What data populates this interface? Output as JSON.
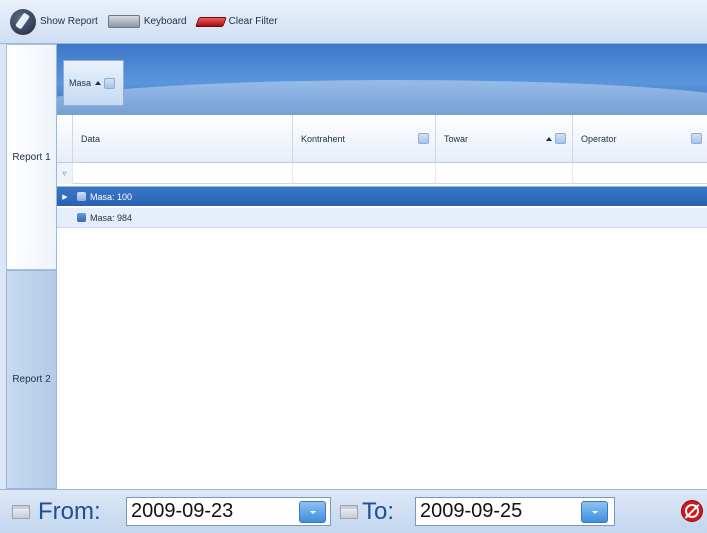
{
  "toolbar": {
    "show_report_label": "Show Report",
    "keyboard_label": "Keyboard",
    "clear_filter_label": "Clear Filter"
  },
  "tabs": [
    {
      "label": "Report 1",
      "selected": true
    },
    {
      "label": "Report 2",
      "selected": false
    }
  ],
  "grid": {
    "group_by_column": "Masa",
    "columns": [
      {
        "label": "Data"
      },
      {
        "label": "Kontrahent"
      },
      {
        "label": "Towar"
      },
      {
        "label": "Operator"
      }
    ],
    "rows": [
      {
        "label": "Masa: 100",
        "selected": true
      },
      {
        "label": "Masa: 984",
        "selected": false
      }
    ]
  },
  "date_range": {
    "from_label": "From:",
    "from_value": "2009-09-23",
    "to_label": "To:",
    "to_value": "2009-09-25"
  },
  "icons": {
    "report": "report-pen-icon",
    "keyboard": "keyboard-icon",
    "clear_filter": "eraser-icon",
    "calendar": "calendar-icon",
    "cancel": "cancel-icon"
  },
  "colors": {
    "accent": "#2f6cbc",
    "selected_row": "#3a77c9",
    "date_label": "#1f4f96",
    "cancel": "#d21818"
  }
}
